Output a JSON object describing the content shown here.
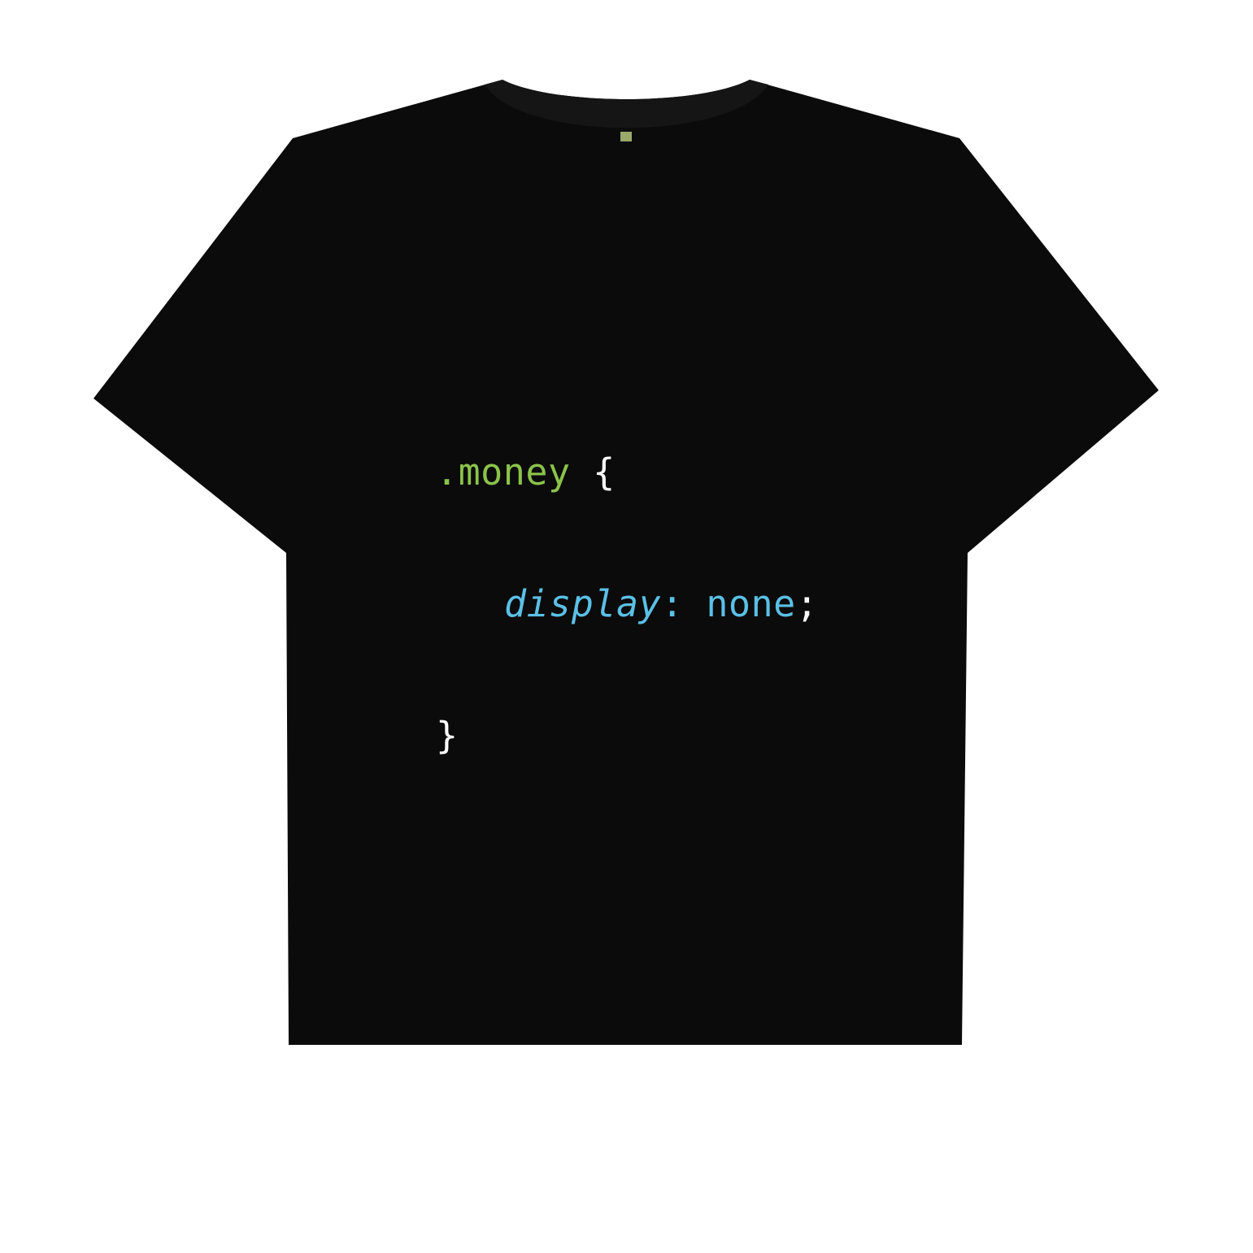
{
  "colors": {
    "shirt": "#0b0b0b",
    "collar": "#151515",
    "label": "#9aa86a",
    "selector": "#8bc34a",
    "brace": "#ffffff",
    "property": "#5bc0e6",
    "value": "#5bc0e6"
  },
  "code": {
    "selector": ".money",
    "open_brace": "{",
    "property": "display",
    "colon": ":",
    "value": "none",
    "semicolon": ";",
    "close_brace": "}"
  }
}
